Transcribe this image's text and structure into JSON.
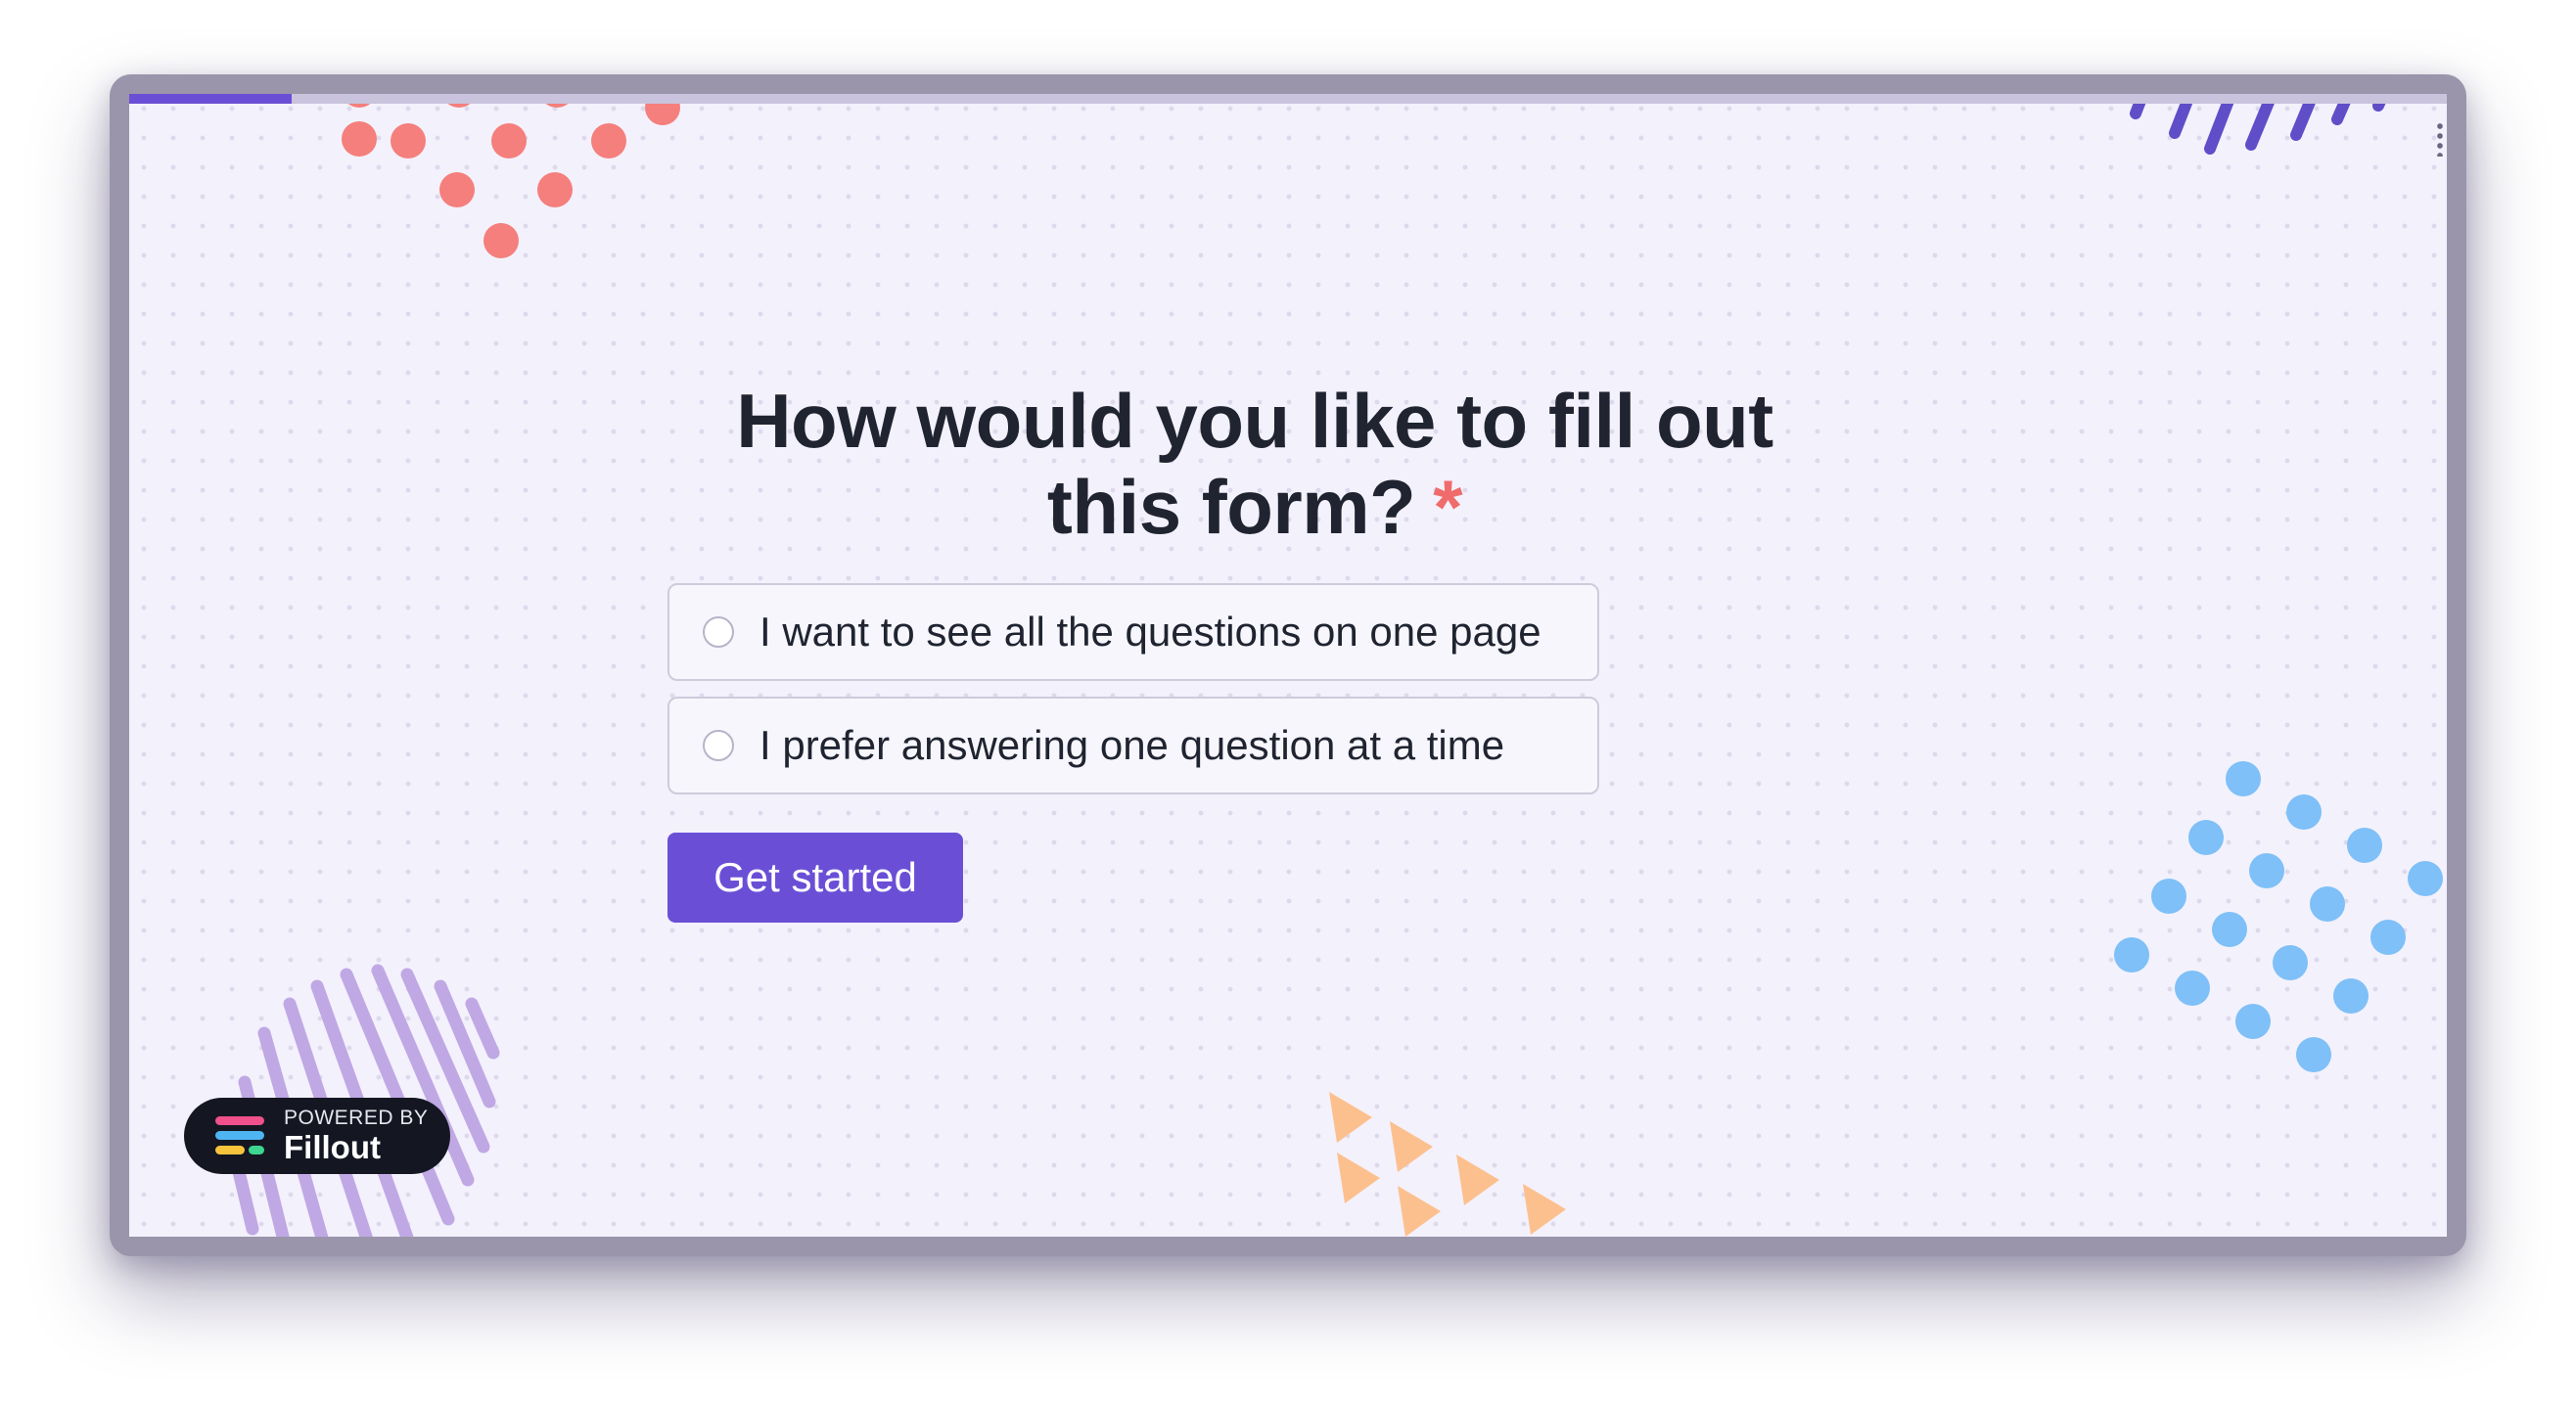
{
  "progress": {
    "percent": 7
  },
  "question": {
    "title": "How would you like to fill out this form?",
    "required_mark": "*"
  },
  "options": [
    {
      "label": "I want to see all the questions on one page"
    },
    {
      "label": "I prefer answering one question at a time"
    }
  ],
  "button": {
    "label": "Get started"
  },
  "badge": {
    "powered_by": "POWERED BY",
    "brand": "Fillout",
    "logo_colors": [
      "#f0508c",
      "#4fb4f2",
      "#f8c43c",
      "#3dd58f"
    ]
  },
  "colors": {
    "accent": "#6a4fd6",
    "background": "#f3f1fc",
    "required": "#f06b6b",
    "decor_coral": "#f47f7c",
    "decor_blue": "#7ec0f7",
    "decor_lavender": "#c0a8e4",
    "decor_peach": "#fcc08f",
    "decor_indigo": "#5f4ec8"
  }
}
